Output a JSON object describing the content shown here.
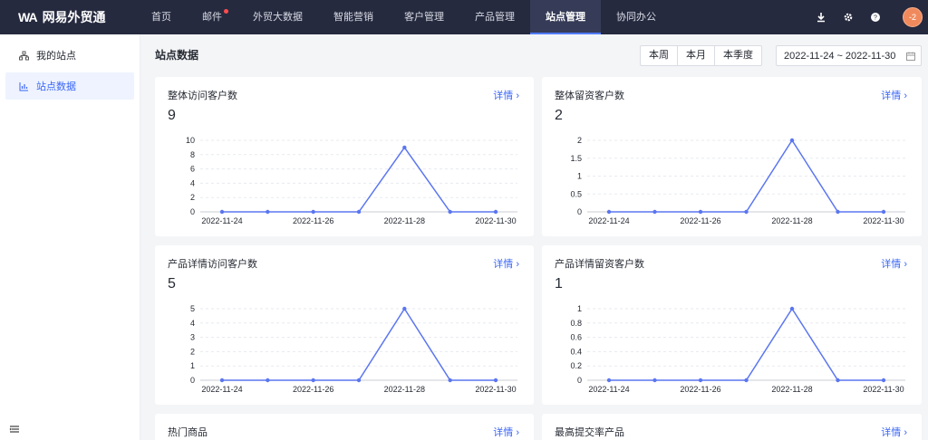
{
  "brand": {
    "name": "网易外贸通",
    "mark": "WA"
  },
  "nav": [
    {
      "label": "首页",
      "active": false,
      "dot": false
    },
    {
      "label": "邮件",
      "active": false,
      "dot": true
    },
    {
      "label": "外贸大数据",
      "active": false,
      "dot": false
    },
    {
      "label": "智能营销",
      "active": false,
      "dot": false
    },
    {
      "label": "客户管理",
      "active": false,
      "dot": false
    },
    {
      "label": "产品管理",
      "active": false,
      "dot": false
    },
    {
      "label": "站点管理",
      "active": true,
      "dot": false
    },
    {
      "label": "协同办公",
      "active": false,
      "dot": false
    }
  ],
  "user": {
    "avatar_text": "-2"
  },
  "sidebar": {
    "items": [
      {
        "label": "我的站点",
        "icon": "sitemap-icon",
        "active": false
      },
      {
        "label": "站点数据",
        "icon": "bar-chart-icon",
        "active": true
      }
    ]
  },
  "page": {
    "title": "站点数据"
  },
  "range_tabs": [
    "本周",
    "本月",
    "本季度"
  ],
  "date_range": {
    "start": "2022-11-24",
    "sep": "~",
    "end": "2022-11-30"
  },
  "colors": {
    "accent": "#3a66f6",
    "line": "#5b76f0",
    "topbar": "#262a3f"
  },
  "cards": [
    {
      "title": "整体访问客户数",
      "link": "详情",
      "value": "9"
    },
    {
      "title": "整体留资客户数",
      "link": "详情",
      "value": "2"
    },
    {
      "title": "产品详情访问客户数",
      "link": "详情",
      "value": "5"
    },
    {
      "title": "产品详情留资客户数",
      "link": "详情",
      "value": "1"
    },
    {
      "title": "热门商品",
      "link": "详情",
      "value": ""
    },
    {
      "title": "最高提交率产品",
      "link": "详情",
      "value": ""
    }
  ],
  "chart_data": [
    {
      "type": "line",
      "x": [
        "2022-11-24",
        "2022-11-25",
        "2022-11-26",
        "2022-11-27",
        "2022-11-28",
        "2022-11-29",
        "2022-11-30"
      ],
      "values": [
        0,
        0,
        0,
        0,
        9,
        0,
        0
      ],
      "yticks": [
        "0",
        "2",
        "4",
        "6",
        "8",
        "10"
      ],
      "ylim": [
        0,
        10
      ],
      "xticks": [
        "2022-11-24",
        "2022-11-26",
        "2022-11-28",
        "2022-11-30"
      ]
    },
    {
      "type": "line",
      "x": [
        "2022-11-24",
        "2022-11-25",
        "2022-11-26",
        "2022-11-27",
        "2022-11-28",
        "2022-11-29",
        "2022-11-30"
      ],
      "values": [
        0,
        0,
        0,
        0,
        2,
        0,
        0
      ],
      "yticks": [
        "0",
        "0.5",
        "1",
        "1.5",
        "2"
      ],
      "ylim": [
        0,
        2
      ],
      "xticks": [
        "2022-11-24",
        "2022-11-26",
        "2022-11-28",
        "2022-11-30"
      ]
    },
    {
      "type": "line",
      "x": [
        "2022-11-24",
        "2022-11-25",
        "2022-11-26",
        "2022-11-27",
        "2022-11-28",
        "2022-11-29",
        "2022-11-30"
      ],
      "values": [
        0,
        0,
        0,
        0,
        5,
        0,
        0
      ],
      "yticks": [
        "0",
        "1",
        "2",
        "3",
        "4",
        "5"
      ],
      "ylim": [
        0,
        5
      ],
      "xticks": [
        "2022-11-24",
        "2022-11-26",
        "2022-11-28",
        "2022-11-30"
      ]
    },
    {
      "type": "line",
      "x": [
        "2022-11-24",
        "2022-11-25",
        "2022-11-26",
        "2022-11-27",
        "2022-11-28",
        "2022-11-29",
        "2022-11-30"
      ],
      "values": [
        0,
        0,
        0,
        0,
        1,
        0,
        0
      ],
      "yticks": [
        "0",
        "0.2",
        "0.4",
        "0.6",
        "0.8",
        "1"
      ],
      "ylim": [
        0,
        1
      ],
      "xticks": [
        "2022-11-24",
        "2022-11-26",
        "2022-11-28",
        "2022-11-30"
      ]
    }
  ]
}
